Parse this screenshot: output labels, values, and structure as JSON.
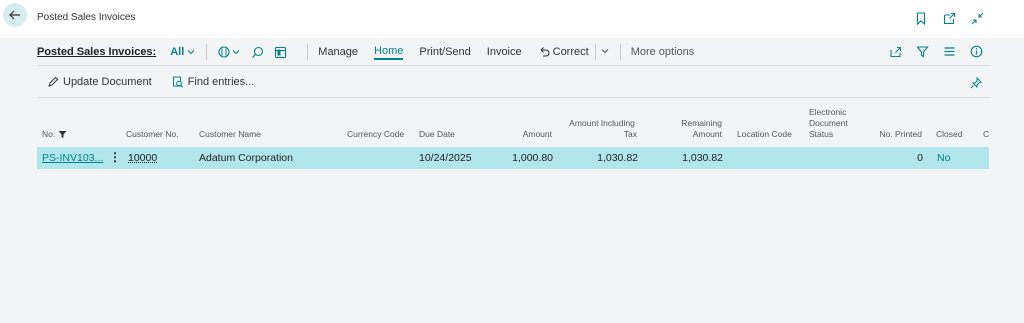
{
  "page": {
    "title": "Posted Sales Invoices"
  },
  "action_bar": {
    "title": "Posted Sales Invoices:",
    "view": "All",
    "menu": [
      "Manage",
      "Home",
      "Print/Send",
      "Invoice"
    ],
    "correct": "Correct",
    "more": "More options"
  },
  "sub_actions": {
    "update": "Update Document",
    "find": "Find entries..."
  },
  "columns": {
    "no": "No.",
    "customer_no": "Customer No.",
    "customer_name": "Customer Name",
    "currency_code": "Currency Code",
    "due_date": "Due Date",
    "amount": "Amount",
    "amount_incl_tax_1": "Amount Including",
    "amount_incl_tax_2": "Tax",
    "remaining_1": "Remaining",
    "remaining_2": "Amount",
    "location_code": "Location Code",
    "edoc_1": "Electronic",
    "edoc_2": "Document",
    "edoc_3": "Status",
    "no_printed": "No. Printed",
    "closed": "Closed",
    "cut": "C"
  },
  "rows": [
    {
      "no": "PS-INV103...",
      "customer_no": "10000",
      "customer_name": "Adatum Corporation",
      "currency_code": "",
      "due_date": "10/24/2025",
      "amount": "1,000.80",
      "amount_incl_tax": "1,030.82",
      "remaining": "1,030.82",
      "location_code": "",
      "edoc_status": "",
      "no_printed": "0",
      "closed": "No"
    }
  ],
  "colors": {
    "accent": "#00838a",
    "selected_row": "#b1e7ec",
    "background": "#f3f4f6"
  }
}
